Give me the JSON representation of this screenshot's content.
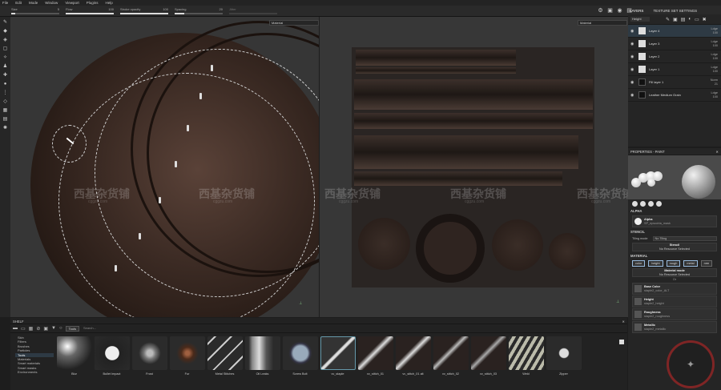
{
  "menu": [
    "File",
    "Edit",
    "Mode",
    "Window",
    "Viewport",
    "Plugins",
    "Help"
  ],
  "tool_options": [
    {
      "label": "Size",
      "value": "5"
    },
    {
      "label": "Flow",
      "value": "100"
    },
    {
      "label": "Stroke opacity",
      "value": "100"
    },
    {
      "label": "Spacing",
      "value": "20"
    },
    {
      "label": "Jitter",
      "value": ""
    }
  ],
  "viewports": {
    "left_mode": "Material",
    "right_mode": "Material"
  },
  "right_tabs": [
    "LAYERS",
    "TEXTURE SET SETTINGS"
  ],
  "layers": {
    "channel": "Height",
    "items": [
      {
        "name": "Layer 4",
        "blend": "Ldge",
        "opacity": "100",
        "thumb": "light",
        "active": true
      },
      {
        "name": "Layer 3",
        "blend": "Ldge",
        "opacity": "100",
        "thumb": "light",
        "active": false
      },
      {
        "name": "Layer 2",
        "blend": "Ldge",
        "opacity": "100",
        "thumb": "light",
        "active": false
      },
      {
        "name": "Layer 1",
        "blend": "Ldge",
        "opacity": "100",
        "thumb": "light",
        "active": false
      },
      {
        "name": "Fill layer 1",
        "blend": "Norm",
        "opacity": "21",
        "thumb": "dark",
        "active": false
      },
      {
        "name": "Leather Medium Grain",
        "blend": "Ldge",
        "opacity": "100",
        "thumb": "dark",
        "active": false
      }
    ]
  },
  "properties": {
    "title": "PROPERTIES - PAINT",
    "alpha_section": "ALPHA",
    "alpha_title": "Alpha",
    "alpha_value": "SP_epsodria_mask",
    "stencil_section": "STENCIL",
    "tiling_label": "Tiling mode",
    "tiling_value": "No Tiling",
    "stencil_title": "Stencil",
    "stencil_value": "No Resource Selected",
    "material_section": "MATERIAL",
    "channels": [
      "color",
      "height",
      "rough",
      "metal",
      "nrm"
    ],
    "material_mode_title": "Material mode",
    "material_mode_value": "No Resource Selected",
    "or": "Or",
    "slots": [
      {
        "title": "Base Color",
        "value": "staple2_color_ALT"
      },
      {
        "title": "Height",
        "value": "staple2_height"
      },
      {
        "title": "Roughness",
        "value": "staple2_roughness"
      },
      {
        "title": "Metallic",
        "value": "staple2_metallic"
      }
    ]
  },
  "watermark": {
    "text": "西基杂货铺",
    "sub": "cggzu.com"
  },
  "emblem": "✦",
  "shelf": {
    "title": "SHELF",
    "filter_tag": "Tools",
    "search_placeholder": "Search...",
    "categories": [
      "Skin",
      "Filters",
      "Brushes",
      "Particles",
      "Tools",
      "Materials",
      "Smart materials",
      "Smart masks",
      "Environments"
    ],
    "active_category": 4,
    "items": [
      "Blur",
      "Bullet Impact",
      "Frost",
      "Fur",
      "Metal Stitches",
      "Oil Leaks",
      "Screw Bolt",
      "vv_staple",
      "vv_stitch_01",
      "vv_stitch_01 alt",
      "vv_stitch_02",
      "vv_stitch_03",
      "Weld",
      "Zipper"
    ],
    "active_item": 7
  }
}
